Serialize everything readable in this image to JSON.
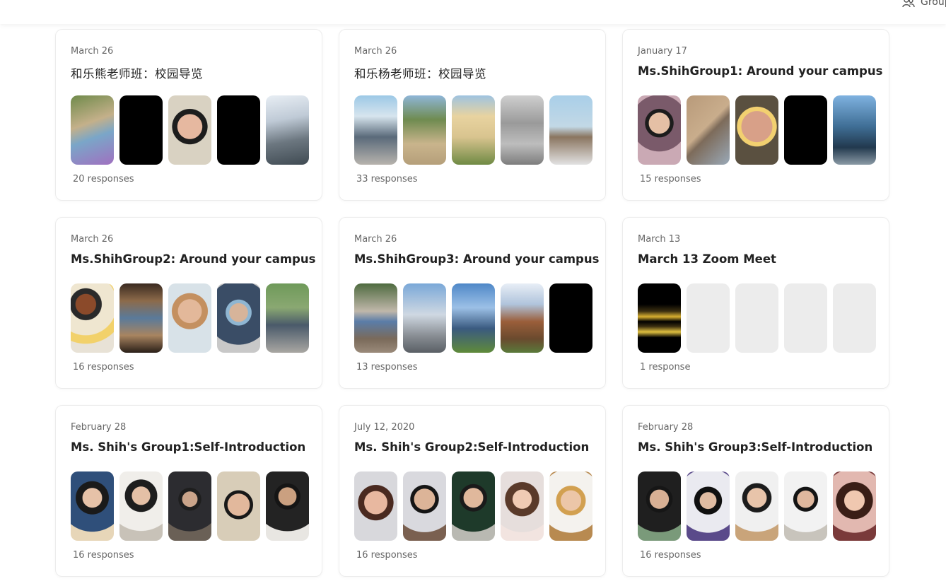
{
  "header": {
    "group_label": "Groups"
  },
  "colors": {
    "border": "#ececec",
    "empty_thumb": "#ececec"
  },
  "cards": [
    {
      "date": "March 26",
      "title": "和乐熊老师班：校园导览",
      "responses": "20 responses",
      "light": true,
      "thumbs": [
        {
          "kind": "photo",
          "bg": "linear-gradient(160deg,#6f8a4a 0%,#c4b08a 40%,#7aa6c8 60%,#a070c0 100%)"
        },
        {
          "kind": "black"
        },
        {
          "kind": "photo",
          "bg": "radial-gradient(circle at 50% 45%,#e6b8a0 0 28%,#1d1d1d 29% 40%,#d9d2c2 41%)"
        },
        {
          "kind": "black"
        },
        {
          "kind": "photo",
          "bg": "linear-gradient(170deg,#e8eef4 0%,#bfcad6 35%,#6c7780 65%,#3f4a52 100%)"
        }
      ]
    },
    {
      "date": "March 26",
      "title": "和乐杨老师班：校园导览",
      "responses": "33 responses",
      "light": true,
      "thumbs": [
        {
          "kind": "photo",
          "bg": "linear-gradient(180deg,#9cc8e6 0%,#d7e5ee 30%,#5a6a7a 60%,#b7b3ad 100%)"
        },
        {
          "kind": "photo",
          "bg": "linear-gradient(180deg,#8fb6d8 0%,#6f8b50 35%,#c9b48c 70%,#b59f7a 100%)"
        },
        {
          "kind": "photo",
          "bg": "linear-gradient(180deg,#9fc3e0 0%,#e8d3a0 30%,#d9c48f 60%,#6f8a44 100%)"
        },
        {
          "kind": "photo",
          "bg": "linear-gradient(180deg,#cfcfcf 0%,#9a9a9a 40%,#bdbdbd 70%,#7d7d7d 100%)"
        },
        {
          "kind": "photo",
          "bg": "linear-gradient(180deg,#a9cfe8 0%,#c2d8e6 45%,#8a7560 60%,#e2e2e2 100%)"
        }
      ]
    },
    {
      "date": "January 17",
      "title": "Ms.ShihGroup1: Around your campus",
      "responses": "15 responses",
      "light": false,
      "thumbs": [
        {
          "kind": "photo",
          "bg": "radial-gradient(circle at 50% 40%,#e5c0a5 0 22%,#1c1c1c 23% 30%,#7a5a6a 31% 60%,#caa9b4 61%)"
        },
        {
          "kind": "photo",
          "bg": "linear-gradient(135deg,#b89a7a 0%,#c9ad8c 45%,#7d6b5a 55%,#9aa9b8 100%)"
        },
        {
          "kind": "photo",
          "bg": "radial-gradient(circle at 50% 45%,#d8a088 0 35%,#f2d070 36% 45%,#5a5040 46%)"
        },
        {
          "kind": "black"
        },
        {
          "kind": "photo",
          "bg": "linear-gradient(180deg,#7fb2e0 0%,#3f6e95 45%,#22394e 75%,#8a9aa5 100%)"
        }
      ]
    },
    {
      "date": "March 26",
      "title": "Ms.ShihGroup2: Around your campus",
      "responses": "16 responses",
      "light": false,
      "thumbs": [
        {
          "kind": "photo",
          "bg": "radial-gradient(circle at 35% 30%,#8b4a2a 0 18%,#2a2a2a 19% 28%,#efe6d0 29% 55%,#f2d16a 56% 70%,#e8e2d6 71%)"
        },
        {
          "kind": "photo",
          "bg": "linear-gradient(180deg,#3a2a20 0%,#8c6a4a 25%,#5a7a9a 50%,#a88460 75%,#2a1f18 100%)"
        },
        {
          "kind": "photo",
          "bg": "radial-gradient(circle at 50% 40%,#e3b89a 0 25%,#c49060 26% 38%,#d8e2e8 39%)"
        },
        {
          "kind": "photo",
          "bg": "radial-gradient(circle at 50% 42%,#d7b49a 0 20%,#8fb6d2 21% 28%,#3a4d66 29% 70%,#c8c8c8 71%)"
        },
        {
          "kind": "photo",
          "bg": "linear-gradient(180deg,#6f9a5a 0%,#8aa872 35%,#4a5a6a 60%,#a9a7a2 100%)"
        }
      ]
    },
    {
      "date": "March 26",
      "title": "Ms.ShihGroup3: Around your campus",
      "responses": "13 responses",
      "light": false,
      "thumbs": [
        {
          "kind": "photo",
          "bg": "linear-gradient(180deg,#4f6b40 0%,#c0b7aa 40%,#5a7da8 55%,#7a6a5a 80%,#9a8a7a 100%)"
        },
        {
          "kind": "photo",
          "bg": "linear-gradient(180deg,#7aa8d8 0%,#cfd8e2 45%,#8a8f95 75%,#5a5f65 100%)"
        },
        {
          "kind": "photo",
          "bg": "linear-gradient(180deg,#4f88c8 0%,#9cc0e6 35%,#3a5a80 65%,#5f8a3a 100%)"
        },
        {
          "kind": "photo",
          "bg": "linear-gradient(180deg,#e8eef6 0%,#b0c4dc 30%,#9a5e3a 55%,#6a4a2e 80%,#5a7a3a 100%)"
        },
        {
          "kind": "black"
        }
      ]
    },
    {
      "date": "March 13",
      "title": "March 13 Zoom Meet",
      "responses": "1 response",
      "light": false,
      "thumbs": [
        {
          "kind": "photo",
          "bg": "linear-gradient(180deg,#000 0%,#000 30%,#3a2e10 40%,#d8b030 48%,#000 55%,#3a2e10 62%,#e0c040 70%,#000 78%,#000 100%)"
        },
        {
          "kind": "empty"
        },
        {
          "kind": "empty"
        },
        {
          "kind": "empty"
        },
        {
          "kind": "empty"
        }
      ]
    },
    {
      "date": "February 28",
      "title": "Ms. Shih's Group1:Self-Introduction",
      "responses": "16 responses",
      "light": false,
      "thumbs": [
        {
          "kind": "photo",
          "bg": "radial-gradient(circle at 50% 38%,#e6c2a8 0 20%,#1a1a1a 21% 34%,#2f4f7a 35% 70%,#e7d6b8 71%)"
        },
        {
          "kind": "photo",
          "bg": "radial-gradient(circle at 50% 35%,#e4c0a6 0 18%,#1d1d1d 19% 32%,#f0eeea 33% 70%,#c8c2b8 71%)"
        },
        {
          "kind": "photo",
          "bg": "radial-gradient(circle at 50% 40%,#caa48a 0 16%,#1e1e1e 17% 24%,#2c2c30 25% 68%,#6a6056 69%)"
        },
        {
          "kind": "photo",
          "bg": "radial-gradient(circle at 50% 48%,#e2b89c 0 26%,#181818 27% 34%,#d8cdb8 35%)"
        },
        {
          "kind": "photo",
          "bg": "radial-gradient(circle at 50% 36%,#caa080 0 18%,#151515 19% 26%,#232323 27% 70%,#e8e6e2 71%)"
        }
      ]
    },
    {
      "date": "July 12, 2020",
      "title": "Ms. Shih's Group2:Self-Introduction",
      "responses": "16 responses",
      "light": false,
      "thumbs": [
        {
          "kind": "photo",
          "bg": "radial-gradient(circle at 50% 45%,#e8b8a0 0 26%,#4a2a20 27% 40%,#d8d8dc 41%)"
        },
        {
          "kind": "photo",
          "bg": "radial-gradient(circle at 50% 40%,#dcb498 0 22%,#151515 23% 30%,#d9d9de 31% 70%,#7a6050 71%)"
        },
        {
          "kind": "photo",
          "bg": "radial-gradient(circle at 50% 38%,#e0b89c 0 20%,#1a1a1a 21% 28%,#1e3a2a 29% 70%,#b9b9b2 71%)"
        },
        {
          "kind": "photo",
          "bg": "radial-gradient(circle at 50% 40%,#f0cbb4 0 20%,#5a3a2a 21% 36%,#e6dedc 37% 70%,#f2e4e0 71%)"
        },
        {
          "kind": "photo",
          "bg": "radial-gradient(circle at 50% 42%,#ecc6a8 0 22%,#d2a050 23% 32%,#f4f2ee 33% 70%,#b88a50 71%)"
        }
      ]
    },
    {
      "date": "February 28",
      "title": "Ms. Shih's Group3:Self-Introduction",
      "responses": "16 responses",
      "light": false,
      "thumbs": [
        {
          "kind": "photo",
          "bg": "radial-gradient(circle at 50% 40%,#d8b094 0 20%,#161616 21% 28%,#1f1f1f 29% 70%,#7a9a7a 71%)"
        },
        {
          "kind": "photo",
          "bg": "radial-gradient(circle at 50% 42%,#e0bca2 0 18%,#101010 19% 30%,#eaeaf0 31% 70%,#5a4a8a 71%)"
        },
        {
          "kind": "photo",
          "bg": "radial-gradient(circle at 50% 38%,#e8c4aa 0 20%,#1c1c1c 21% 30%,#f0f0f0 31% 70%,#c9a47a 71%)"
        },
        {
          "kind": "photo",
          "bg": "radial-gradient(circle at 50% 40%,#e0b89e 0 18%,#141414 19% 26%,#f2f2f2 27% 70%,#c8c4bc 71%)"
        },
        {
          "kind": "photo",
          "bg": "radial-gradient(circle at 50% 42%,#f0c8b0 0 22%,#3a1e16 23% 40%,#e2b8b0 41% 70%,#7a3a3a 71%)"
        }
      ]
    }
  ]
}
